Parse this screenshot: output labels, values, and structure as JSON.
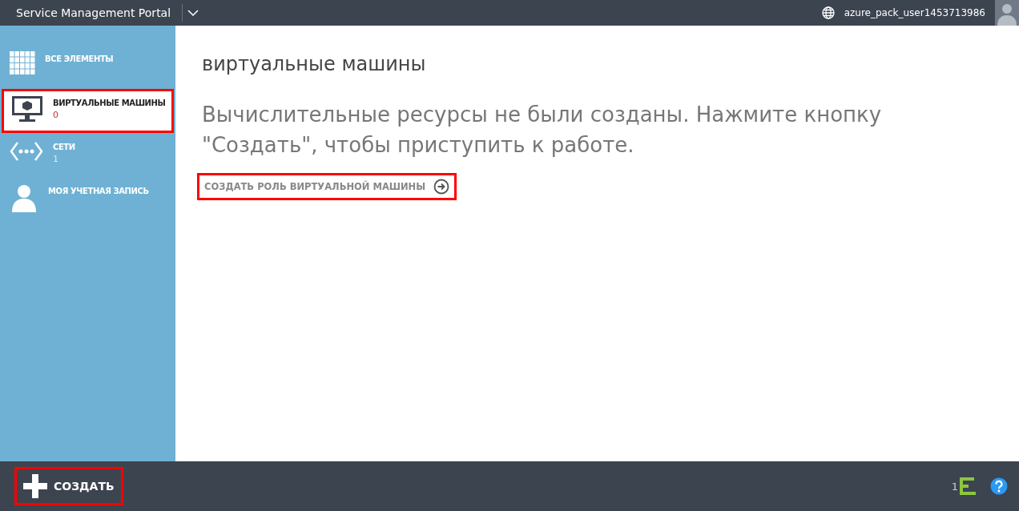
{
  "header": {
    "title": "Service Management Portal",
    "user": "azure_pack_user1453713986"
  },
  "sidebar": {
    "items": [
      {
        "kind": "grid",
        "label": "ВСЕ ЭЛЕМЕНТЫ",
        "selected": false,
        "highlighted": false
      },
      {
        "kind": "monitor",
        "label": "ВИРТУАЛЬНЫЕ МАШИНЫ",
        "count": "0",
        "selected": true,
        "highlighted": true
      },
      {
        "kind": "network",
        "label": "СЕТИ",
        "count": "1",
        "selected": false,
        "highlighted": false
      },
      {
        "kind": "person",
        "label": "МОЯ УЧЕТНАЯ ЗАПИСЬ",
        "selected": false,
        "highlighted": false
      }
    ]
  },
  "main": {
    "title": "виртуальные машины",
    "message": "Вычислительные ресурсы не были созданы. Нажмите кнопку \"Создать\", чтобы приступить к работе.",
    "link": {
      "label": "СОЗДАТЬ РОЛЬ ВИРТУАЛЬНОЙ МАШИНЫ",
      "highlighted": true
    }
  },
  "footer": {
    "create": {
      "label": "СОЗДАТЬ",
      "highlighted": true
    },
    "notifications": "1"
  }
}
